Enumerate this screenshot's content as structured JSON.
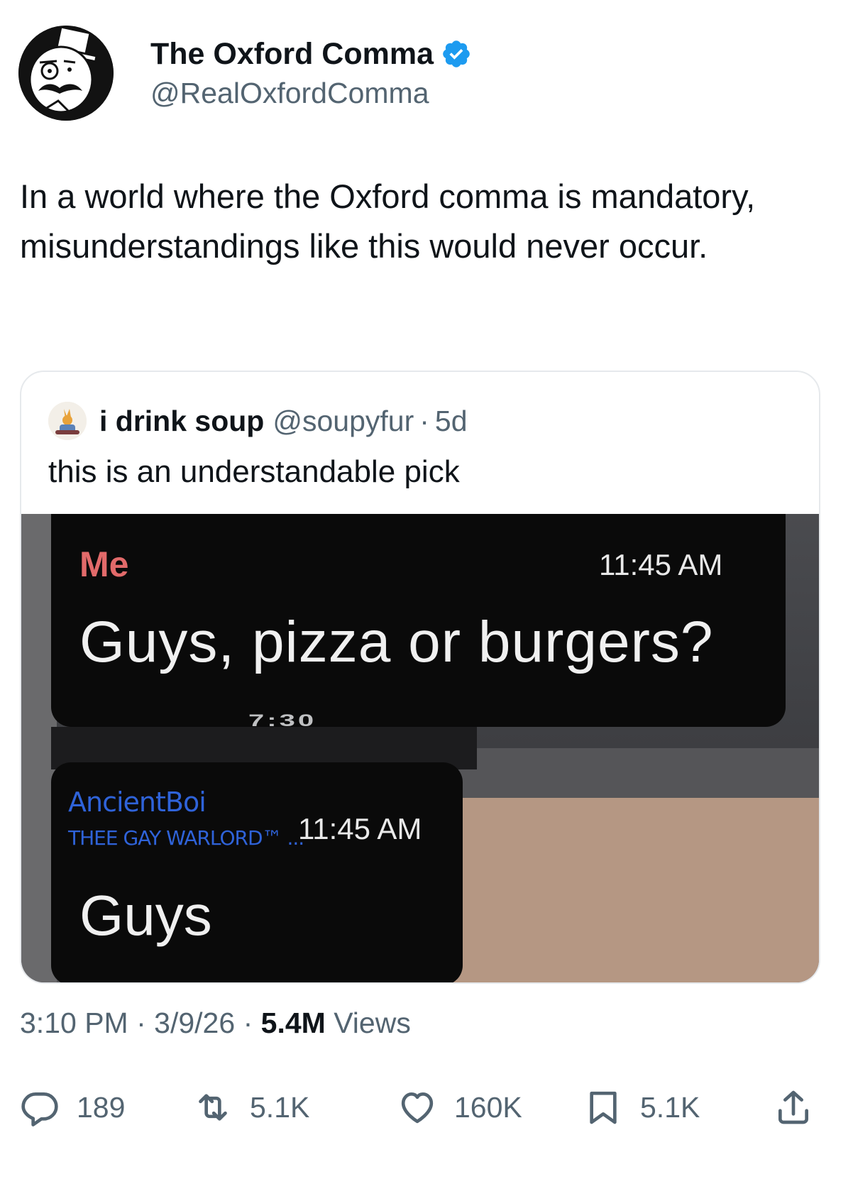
{
  "author": {
    "display_name": "The Oxford Comma",
    "handle": "@RealOxfordComma",
    "verified": true,
    "verified_color": "#1d9bf0"
  },
  "tweet": {
    "text": "In a world where the Oxford comma is mandatory, misunderstandings like this would never occur."
  },
  "quoted": {
    "display_name": "i drink soup",
    "handle": "@soupyfur",
    "separator": "·",
    "age": "5d",
    "text": "this is an understandable pick",
    "media": {
      "sender1": "Me",
      "time1": "11:45 AM",
      "message1": "Guys, pizza or burgers?",
      "sender2": "AncientBoi",
      "sender2_subtitle": "THEE GAY WARLORD™ ...",
      "time2": "11:45 AM",
      "message2": "Guys",
      "sender1_color": "#e26a6a",
      "sender2_color": "#2f63d9"
    }
  },
  "meta": {
    "time": "3:10 PM",
    "date": "3/9/26",
    "separator": "·",
    "views_count": "5.4M",
    "views_label": "Views"
  },
  "actions": {
    "reply_count": "189",
    "retweet_count": "5.1K",
    "like_count": "160K",
    "bookmark_count": "5.1K",
    "icons": [
      "reply-icon",
      "retweet-icon",
      "like-icon",
      "bookmark-icon",
      "share-icon"
    ]
  }
}
